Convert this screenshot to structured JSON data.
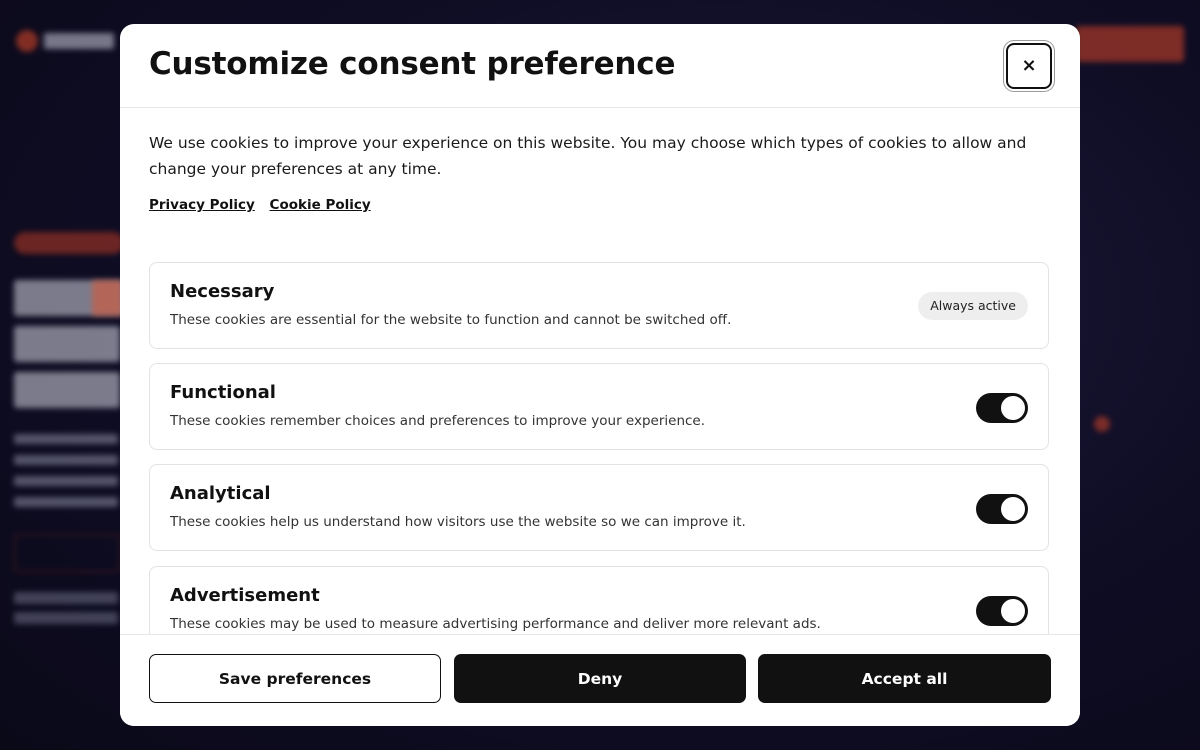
{
  "modal": {
    "title": "Customize consent preference",
    "close_label": "×",
    "intro": "We use cookies to improve your experience on this website. You may choose which types of cookies to allow and change your preferences at any time.",
    "links": [
      "Privacy Policy",
      "Cookie Policy"
    ],
    "categories": [
      {
        "title": "Necessary",
        "description": "These cookies are essential for the website to function and cannot be switched off.",
        "status": "Always active"
      },
      {
        "title": "Functional",
        "description": "These cookies remember choices and preferences to improve your experience.",
        "enabled": true
      },
      {
        "title": "Analytical",
        "description": "These cookies help us understand how visitors use the website so we can improve it.",
        "enabled": true
      },
      {
        "title": "Advertisement",
        "description": "These cookies may be used to measure advertising performance and deliver more relevant ads.",
        "enabled": true
      }
    ],
    "buttons": {
      "save": "Save preferences",
      "deny": "Deny",
      "accept": "Accept all"
    }
  },
  "colors": {
    "accent": "#111111",
    "background_page": "#0f0d24",
    "brand_orange": "#e24a2a"
  }
}
